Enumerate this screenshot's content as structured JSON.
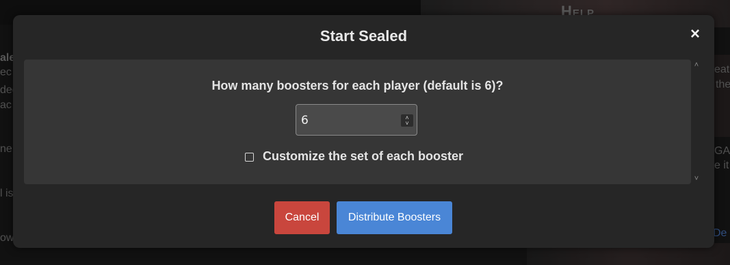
{
  "background": {
    "help_title": "Help",
    "left_fragments": [
      "ale",
      "ec",
      "ded",
      "ac",
      "ne",
      "l is",
      "ow"
    ],
    "right_fragments": [
      "eat",
      "the",
      "GA",
      "e it",
      "De"
    ]
  },
  "modal": {
    "title": "Start Sealed",
    "close_icon": "×",
    "question": "How many boosters for each player (default is 6)?",
    "booster_count": {
      "value": "6",
      "stepper_up": "˄",
      "stepper_down": "˅"
    },
    "customize_label": "Customize the set of each booster",
    "customize_checked": false,
    "scroll_up": "˄",
    "scroll_down": "˅",
    "buttons": {
      "cancel": "Cancel",
      "distribute": "Distribute Boosters"
    }
  },
  "colors": {
    "cancel": "#c9463d",
    "distribute": "#4a86d6",
    "modal_bg": "#262626",
    "body_bg": "#363636"
  }
}
